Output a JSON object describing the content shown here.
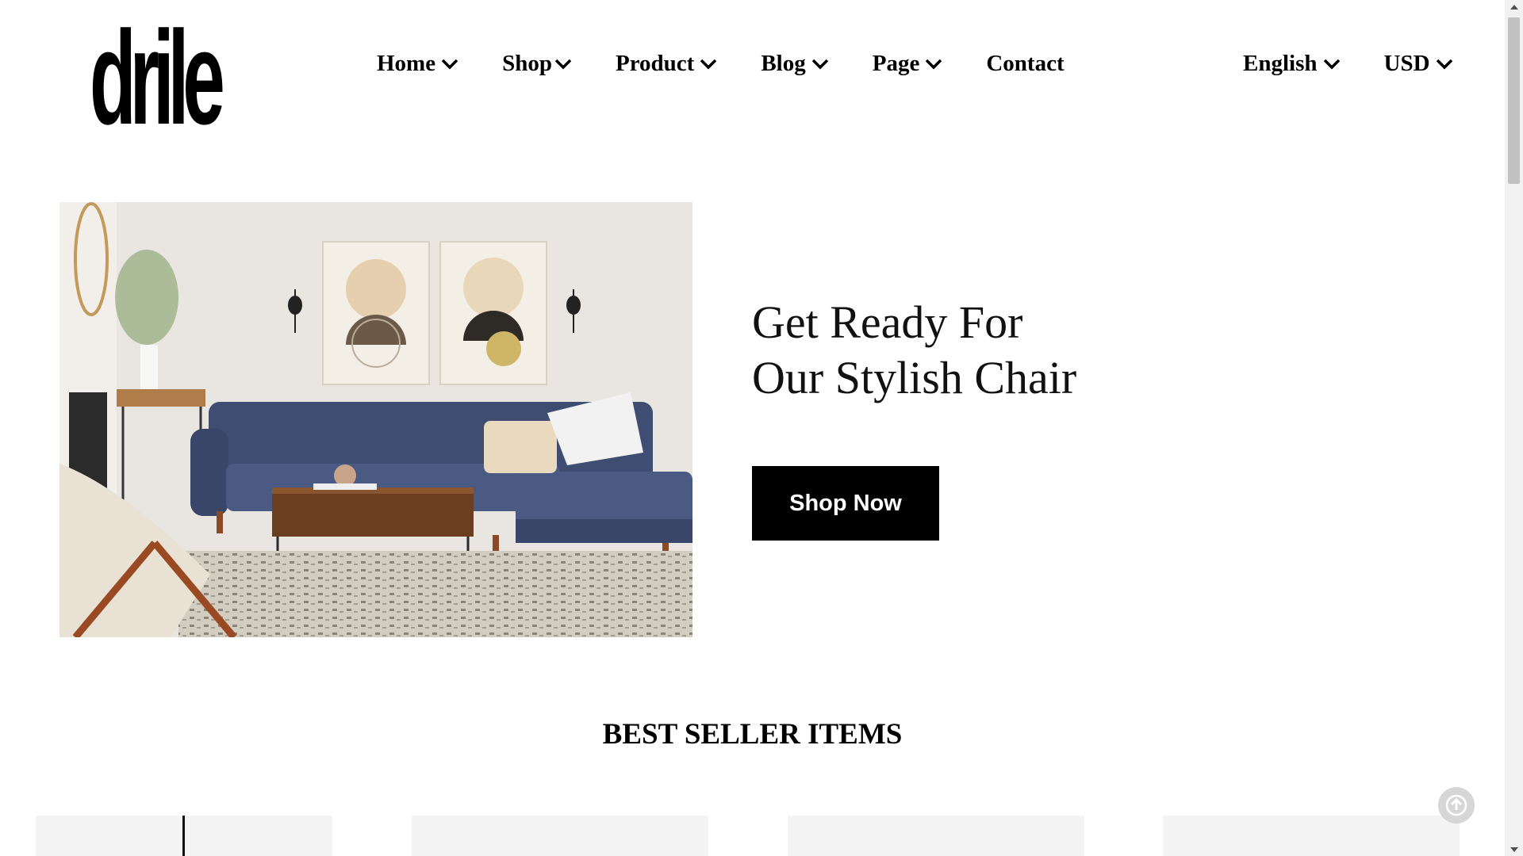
{
  "logo": {
    "text": "drile"
  },
  "nav": {
    "items": [
      {
        "label": "Home",
        "dropdown": true
      },
      {
        "label": "Shop",
        "dropdown": true
      },
      {
        "label": "Product",
        "dropdown": true
      },
      {
        "label": "Blog",
        "dropdown": true
      },
      {
        "label": "Page",
        "dropdown": true
      },
      {
        "label": "Contact",
        "dropdown": false
      }
    ],
    "language": "English",
    "currency": "USD"
  },
  "hero": {
    "heading_line1": "Get Ready For",
    "heading_line2": "Our Stylish Chair",
    "button_label": "Shop Now"
  },
  "best_seller": {
    "title": "BEST SELLER ITEMS"
  },
  "icons": {
    "chevron": "chevron-down-icon",
    "scroll_top": "arrow-up-circle-icon"
  },
  "colors": {
    "primary": "#000000",
    "card_bg": "#f4f4f4",
    "scroll_top_bg": "#d6d6d6"
  }
}
